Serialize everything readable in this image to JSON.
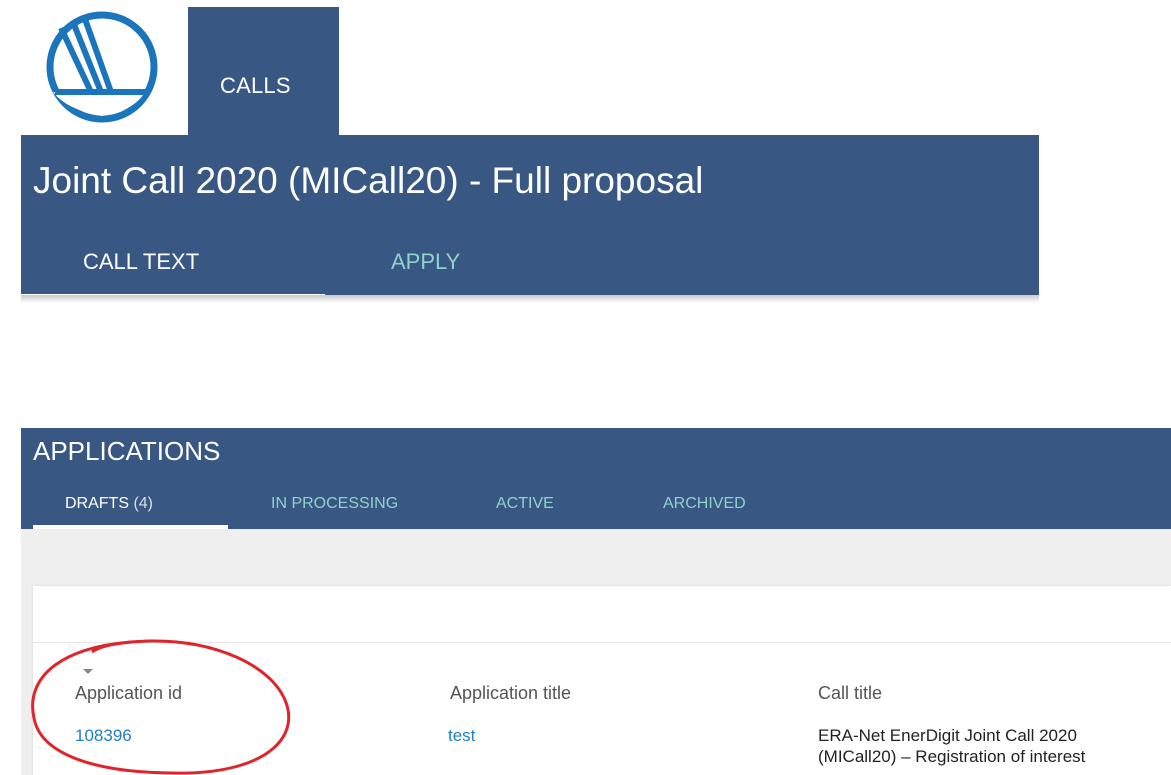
{
  "header": {
    "nav_tab_calls": "CALLS"
  },
  "call": {
    "title": "Joint Call 2020 (MICall20) - Full proposal",
    "tabs": [
      {
        "label": "CALL TEXT",
        "active": true
      },
      {
        "label": "APPLY",
        "active": false
      }
    ]
  },
  "applications": {
    "title": "APPLICATIONS",
    "tabs": [
      {
        "label": "DRAFTS",
        "count": "(4)",
        "active": true
      },
      {
        "label": "IN PROCESSING",
        "active": false
      },
      {
        "label": "ACTIVE",
        "active": false
      },
      {
        "label": "ARCHIVED",
        "active": false
      }
    ],
    "columns": [
      "Application id",
      "Application title",
      "Call title"
    ],
    "rows": [
      {
        "application_id": "108396",
        "application_title": "test",
        "call_title_line1": "ERA-Net EnerDigit Joint Call 2020",
        "call_title_line2": "(MICall20) – Registration of interest"
      }
    ]
  },
  "colors": {
    "brand_blue": "#385783",
    "tab_inactive": "#8fd3c9",
    "link": "#1f7fc6",
    "logo": "#1b75bb",
    "annotation_ring": "#e0242b"
  },
  "icons": {
    "logo": "nordic-swan-logo",
    "sort": "sort-down-icon"
  }
}
